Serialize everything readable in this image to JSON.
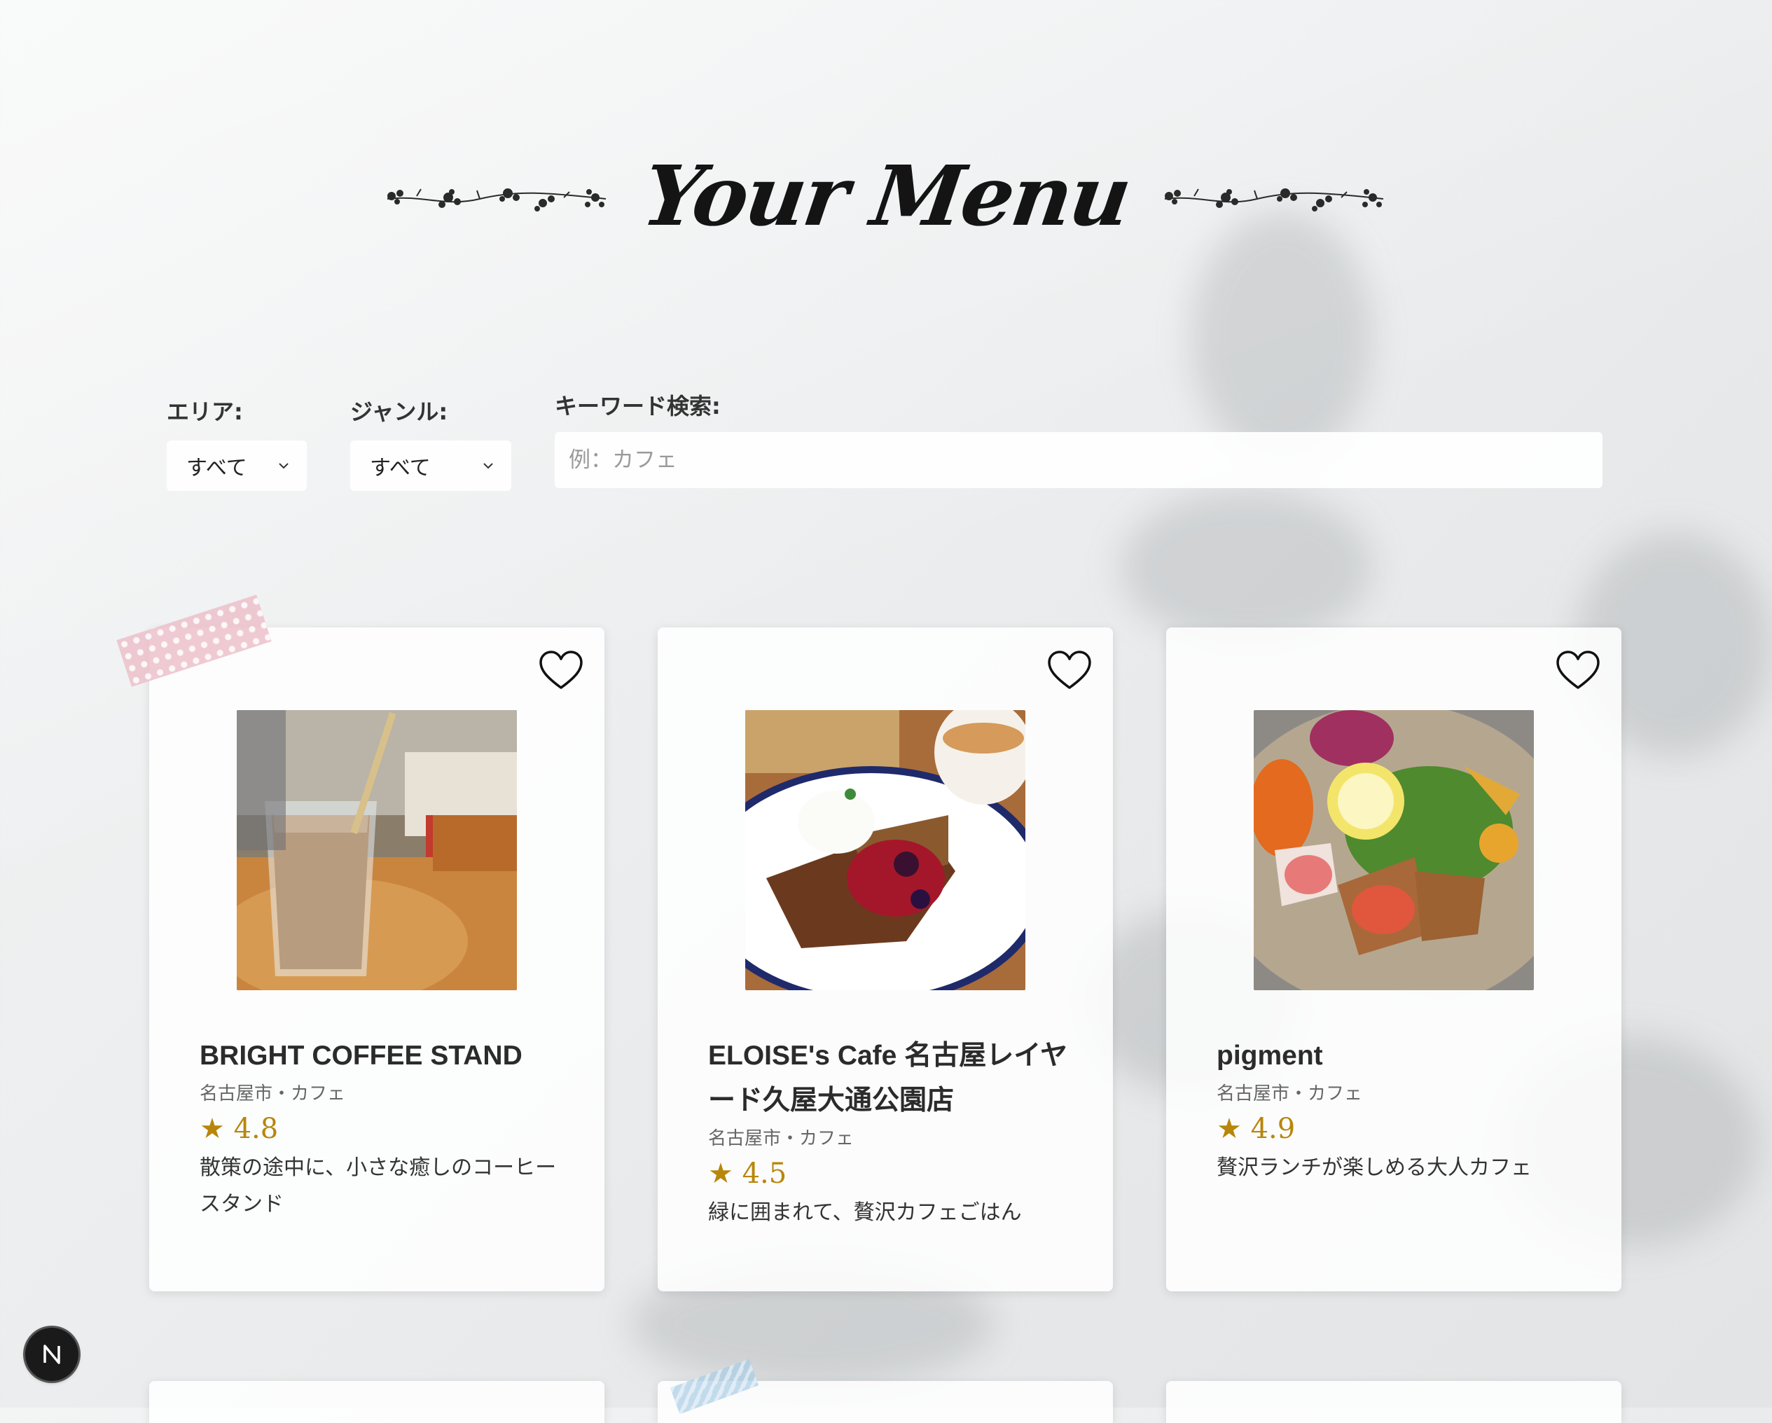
{
  "header": {
    "title": "Your Menu"
  },
  "filters": {
    "area_label": "エリア:",
    "area_value": "すべて",
    "genre_label": "ジャンル:",
    "genre_value": "すべて",
    "keyword_label": "キーワード検索:",
    "keyword_placeholder": "例：カフェ",
    "keyword_value": ""
  },
  "cards": [
    {
      "name": "BRIGHT COFFEE STAND",
      "meta": "名古屋市・カフェ",
      "rating": "★ 4.8",
      "description": "散策の途中に、小さな癒しのコーヒースタンド",
      "favorite": false,
      "photo_icon": "iced-latte-photo"
    },
    {
      "name": "ELOISE's Cafe 名古屋レイヤード久屋大通公園店",
      "meta": "名古屋市・カフェ",
      "rating": "★ 4.5",
      "description": "緑に囲まれて、贅沢カフェごはん",
      "favorite": false,
      "photo_icon": "french-toast-photo"
    },
    {
      "name": "pigment",
      "meta": "名古屋市・カフェ",
      "rating": "★ 4.9",
      "description": "贅沢ランチが楽しめる大人カフェ",
      "favorite": false,
      "photo_icon": "lunch-plate-photo"
    }
  ],
  "colors": {
    "rating": "#b8860b",
    "title": "#141414",
    "tape_pink": "#ecbec8"
  },
  "dev_badge": {
    "letter": "N"
  }
}
